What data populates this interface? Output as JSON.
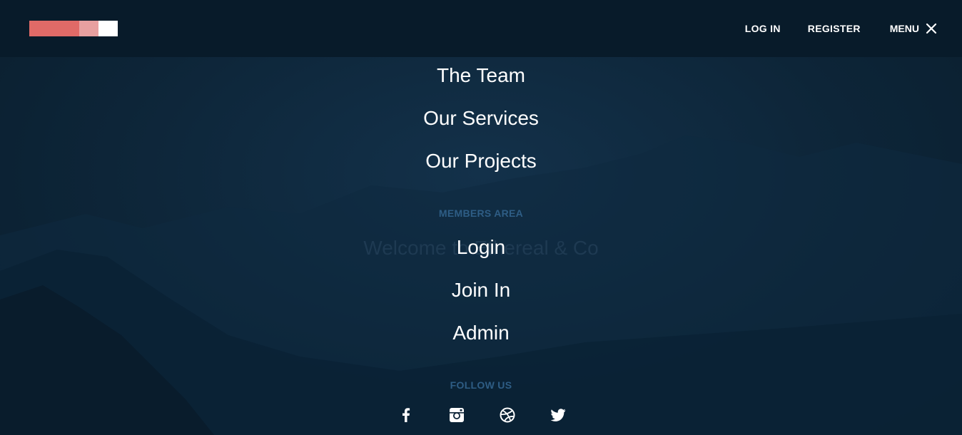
{
  "header": {
    "logo_colors": [
      "#e06a67",
      "#e8a0a0",
      "#ffffff"
    ],
    "login_label": "LOG IN",
    "register_label": "REGISTER",
    "menu_label": "MENU",
    "menu_icon": "close-icon"
  },
  "background": {
    "ghost_title": "Welcome to Ethereal & Co"
  },
  "menu": {
    "main_links": [
      {
        "label": "The Team"
      },
      {
        "label": "Our Services"
      },
      {
        "label": "Our Projects"
      }
    ],
    "members_heading": "MEMBERS AREA",
    "member_links": [
      {
        "label": "Login"
      },
      {
        "label": "Join In"
      },
      {
        "label": "Admin"
      }
    ],
    "follow_heading": "FOLLOW US",
    "social": [
      {
        "icon": "facebook-icon"
      },
      {
        "icon": "instagram-icon"
      },
      {
        "icon": "dribbble-icon"
      },
      {
        "icon": "twitter-icon"
      }
    ]
  },
  "colors": {
    "accent": "#e06a67",
    "section_heading": "#2e5d85",
    "header_bg": "#081b2a"
  }
}
